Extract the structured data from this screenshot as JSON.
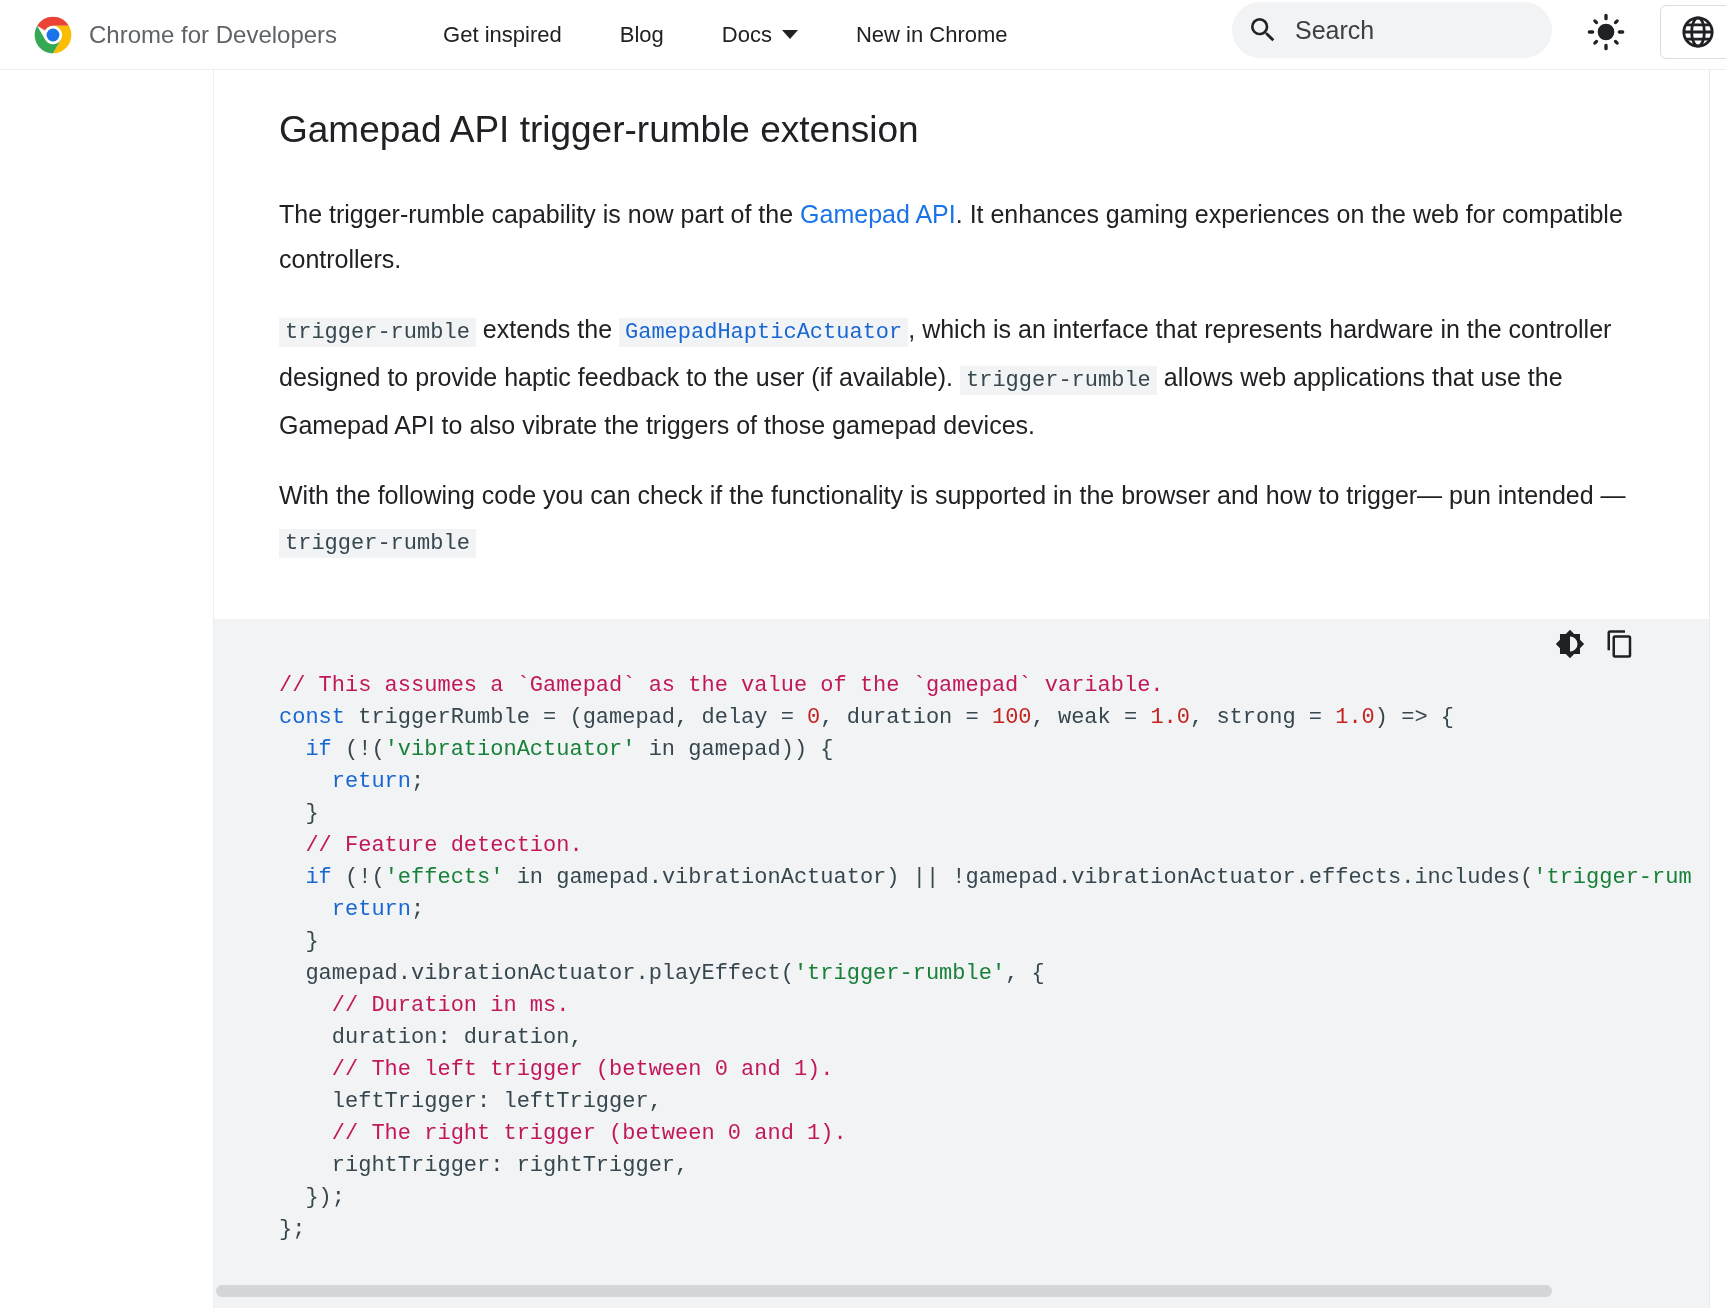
{
  "header": {
    "site_name": "Chrome for Developers",
    "nav": [
      {
        "label": "Get inspired",
        "dropdown": false
      },
      {
        "label": "Blog",
        "dropdown": false
      },
      {
        "label": "Docs",
        "dropdown": true
      },
      {
        "label": "New in Chrome",
        "dropdown": false
      }
    ],
    "search": {
      "placeholder": "Search"
    }
  },
  "article": {
    "title": "Gamepad API trigger-rumble extension",
    "paragraphs": [
      [
        {
          "kind": "text",
          "text": "The trigger-rumble capability is now part of the "
        },
        {
          "kind": "link",
          "text": "Gamepad API"
        },
        {
          "kind": "text",
          "text": ". It enhances gaming experiences on the web for compatible controllers."
        }
      ],
      [
        {
          "kind": "code",
          "text": "trigger-rumble"
        },
        {
          "kind": "text",
          "text": " extends the "
        },
        {
          "kind": "code_link",
          "text": "GamepadHapticActuator"
        },
        {
          "kind": "text",
          "text": ", which is an interface that represents hardware in the controller designed to provide haptic feedback to the user (if available). "
        },
        {
          "kind": "code",
          "text": "trigger-rumble"
        },
        {
          "kind": "text",
          "text": " allows web applications that use the Gamepad API to also vibrate the triggers of those gamepad devices."
        }
      ],
      [
        {
          "kind": "text",
          "text": "With the following code you can check if the functionality is supported in the browser and how to trigger— pun intended — "
        },
        {
          "kind": "code",
          "text": "trigger-rumble"
        }
      ]
    ],
    "code_lines": [
      [
        {
          "kind": "comment",
          "text": "// This assumes a `Gamepad` as the value of the `gamepad` variable."
        }
      ],
      [
        {
          "kind": "keyword",
          "text": "const"
        },
        {
          "kind": "plain",
          "text": " triggerRumble = (gamepad, delay = "
        },
        {
          "kind": "number",
          "text": "0"
        },
        {
          "kind": "plain",
          "text": ", duration = "
        },
        {
          "kind": "number",
          "text": "100"
        },
        {
          "kind": "plain",
          "text": ", weak = "
        },
        {
          "kind": "number",
          "text": "1.0"
        },
        {
          "kind": "plain",
          "text": ", strong = "
        },
        {
          "kind": "number",
          "text": "1.0"
        },
        {
          "kind": "plain",
          "text": ") => {"
        }
      ],
      [
        {
          "kind": "keyword",
          "text": "  if"
        },
        {
          "kind": "plain",
          "text": " (!("
        },
        {
          "kind": "string",
          "text": "'vibrationActuator'"
        },
        {
          "kind": "plain",
          "text": " in gamepad)) {"
        }
      ],
      [
        {
          "kind": "keyword",
          "text": "    return"
        },
        {
          "kind": "plain",
          "text": ";"
        }
      ],
      [
        {
          "kind": "plain",
          "text": "  }"
        }
      ],
      [
        {
          "kind": "comment",
          "text": "  // Feature detection."
        }
      ],
      [
        {
          "kind": "keyword",
          "text": "  if"
        },
        {
          "kind": "plain",
          "text": " (!("
        },
        {
          "kind": "string",
          "text": "'effects'"
        },
        {
          "kind": "plain",
          "text": " in gamepad.vibrationActuator) || !gamepad.vibrationActuator.effects.includes("
        },
        {
          "kind": "string",
          "text": "'trigger-rum"
        }
      ],
      [
        {
          "kind": "keyword",
          "text": "    return"
        },
        {
          "kind": "plain",
          "text": ";"
        }
      ],
      [
        {
          "kind": "plain",
          "text": "  }"
        }
      ],
      [
        {
          "kind": "plain",
          "text": "  gamepad.vibrationActuator.playEffect("
        },
        {
          "kind": "string",
          "text": "'trigger-rumble'"
        },
        {
          "kind": "plain",
          "text": ", {"
        }
      ],
      [
        {
          "kind": "comment",
          "text": "    // Duration in ms."
        }
      ],
      [
        {
          "kind": "plain",
          "text": "    duration: duration,"
        }
      ],
      [
        {
          "kind": "comment",
          "text": "    // The left trigger (between 0 and 1)."
        }
      ],
      [
        {
          "kind": "plain",
          "text": "    leftTrigger: leftTrigger,"
        }
      ],
      [
        {
          "kind": "comment",
          "text": "    // The right trigger (between 0 and 1)."
        }
      ],
      [
        {
          "kind": "plain",
          "text": "    rightTrigger: rightTrigger,"
        }
      ],
      [
        {
          "kind": "plain",
          "text": "  });"
        }
      ],
      [
        {
          "kind": "plain",
          "text": "};"
        }
      ]
    ]
  }
}
